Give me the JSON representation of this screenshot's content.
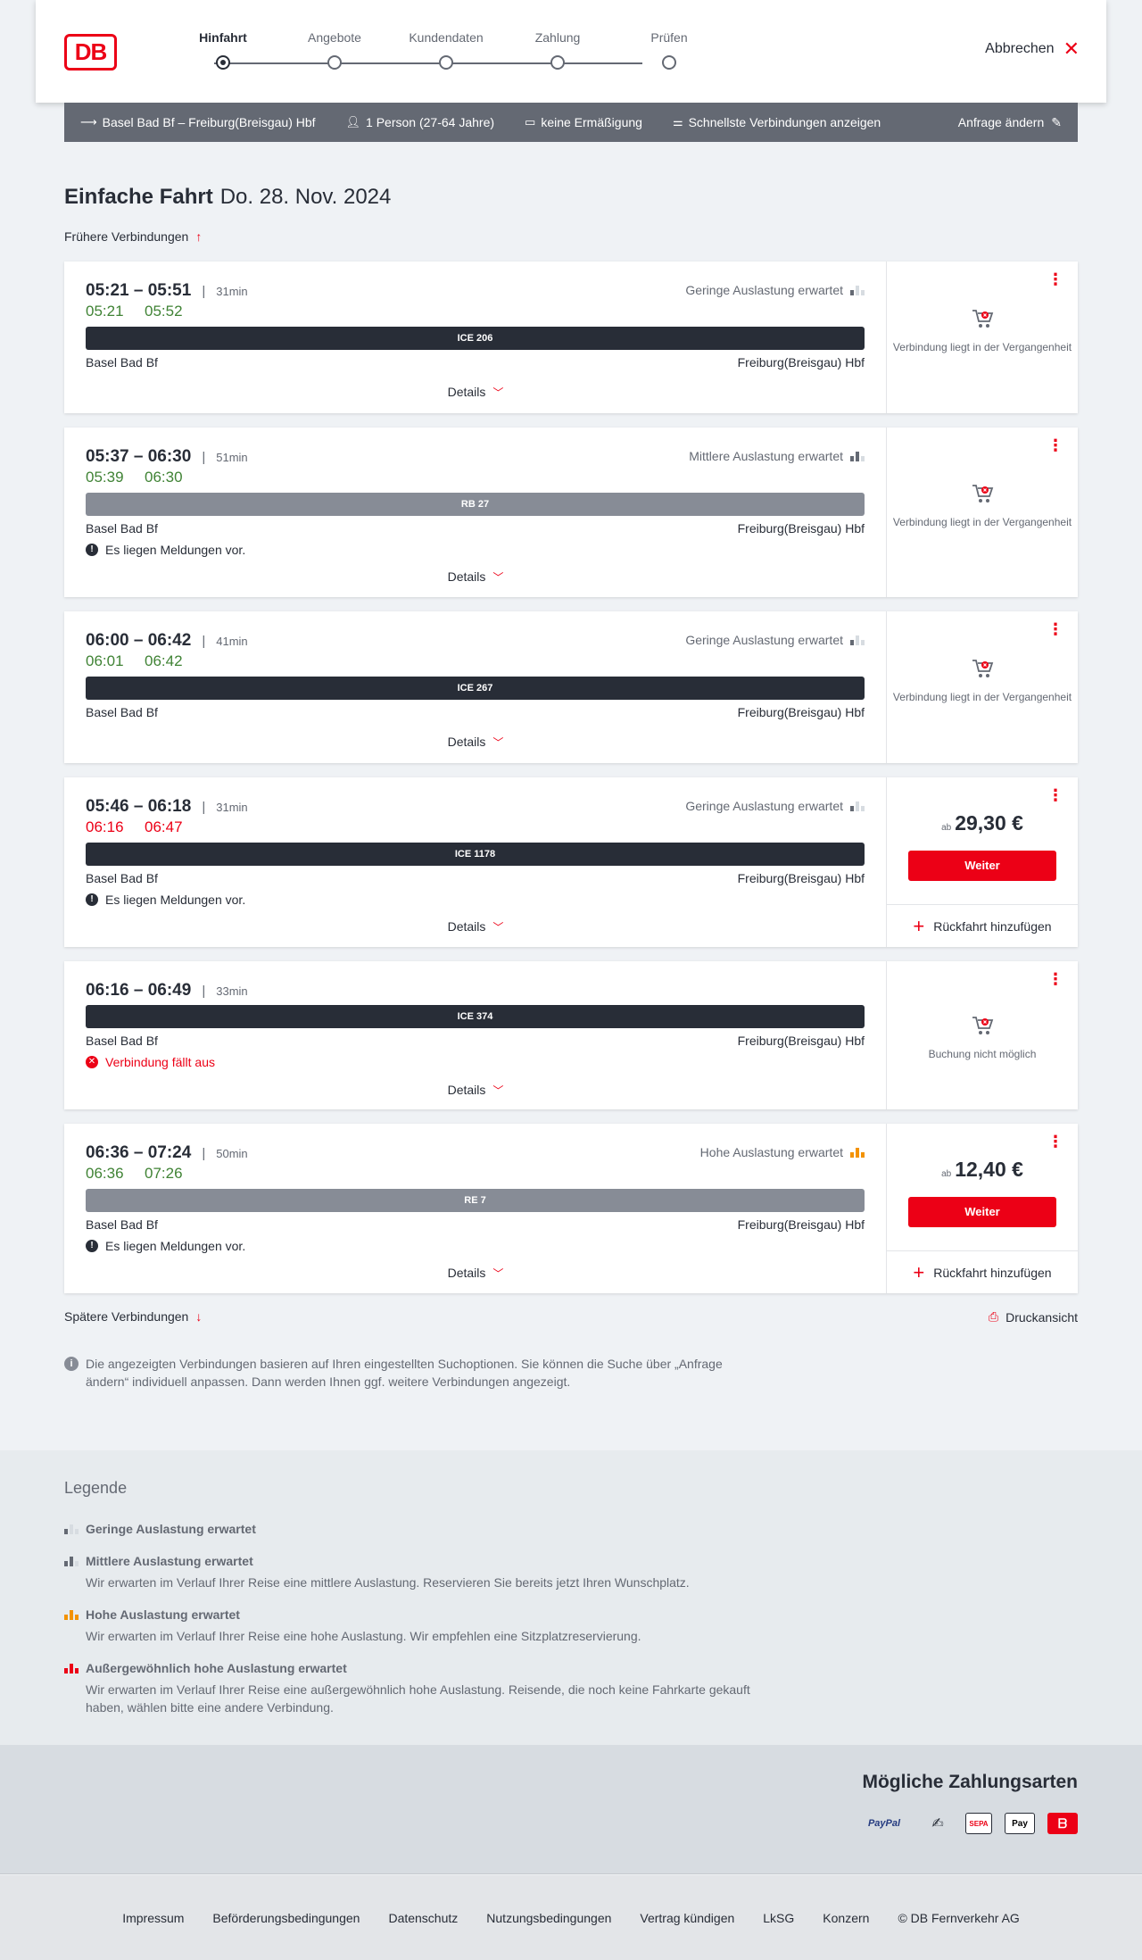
{
  "header": {
    "logo": "DB",
    "steps": [
      {
        "label": "Hinfahrt",
        "active": true
      },
      {
        "label": "Angebote",
        "active": false
      },
      {
        "label": "Kundendaten",
        "active": false
      },
      {
        "label": "Zahlung",
        "active": false
      },
      {
        "label": "Prüfen",
        "active": false
      }
    ],
    "cancel_label": "Abbrechen"
  },
  "summary": {
    "route": "Basel Bad Bf – Freiburg(Breisgau) Hbf",
    "travellers": "1 Person (27-64 Jahre)",
    "discount": "keine Ermäßigung",
    "fastest": "Schnellste Verbindungen anzeigen",
    "edit_label": "Anfrage ändern"
  },
  "title": {
    "type": "Einfache Fahrt",
    "date": "Do. 28. Nov. 2024"
  },
  "earlier_label": "Frühere Verbindungen",
  "later_label": "Spätere Verbindungen",
  "print_label": "Druckansicht",
  "details_label": "Details",
  "connections": [
    {
      "planned": "05:21 – 05:51",
      "duration": "31min",
      "rt_dep": "05:21",
      "rt_arr": "05:52",
      "rt_status": "ok",
      "load": "Geringe Auslastung erwartet",
      "load_level": 1,
      "train": "ICE 206",
      "train_kind": "ice",
      "from": "Basel Bad Bf",
      "to": "Freiburg(Breisgau) Hbf",
      "message": "",
      "side": "past",
      "side_text": "Verbindung liegt in der Vergangenheit"
    },
    {
      "planned": "05:37 – 06:30",
      "duration": "51min",
      "rt_dep": "05:39",
      "rt_arr": "06:30",
      "rt_status": "ok",
      "load": "Mittlere Auslastung erwartet",
      "load_level": 2,
      "train": "RB 27",
      "train_kind": "reg",
      "from": "Basel Bad Bf",
      "to": "Freiburg(Breisgau) Hbf",
      "message": "Es liegen Meldungen vor.",
      "side": "past",
      "side_text": "Verbindung liegt in der Vergangenheit"
    },
    {
      "planned": "06:00 – 06:42",
      "duration": "41min",
      "rt_dep": "06:01",
      "rt_arr": "06:42",
      "rt_status": "ok",
      "load": "Geringe Auslastung erwartet",
      "load_level": 1,
      "train": "ICE 267",
      "train_kind": "ice",
      "from": "Basel Bad Bf",
      "to": "Freiburg(Breisgau) Hbf",
      "message": "",
      "side": "past",
      "side_text": "Verbindung liegt in der Vergangenheit"
    },
    {
      "planned": "05:46 – 06:18",
      "duration": "31min",
      "rt_dep": "06:16",
      "rt_arr": "06:47",
      "rt_status": "late",
      "load": "Geringe Auslastung erwartet",
      "load_level": 1,
      "train": "ICE 1178",
      "train_kind": "ice",
      "from": "Basel Bad Bf",
      "to": "Freiburg(Breisgau) Hbf",
      "message": "Es liegen Meldungen vor.",
      "side": "price",
      "price_prefix": "ab",
      "price": "29,30 €",
      "button": "Weiter",
      "return_label": "Rückfahrt hinzufügen"
    },
    {
      "planned": "06:16 – 06:49",
      "duration": "33min",
      "rt_dep": "",
      "rt_arr": "",
      "rt_status": "none",
      "load": "",
      "load_level": 0,
      "train": "ICE 374",
      "train_kind": "ice",
      "from": "Basel Bad Bf",
      "to": "Freiburg(Breisgau) Hbf",
      "message": "Verbindung fällt aus",
      "side": "unavailable",
      "side_text": "Buchung nicht möglich"
    },
    {
      "planned": "06:36 – 07:24",
      "duration": "50min",
      "rt_dep": "06:36",
      "rt_arr": "07:26",
      "rt_status": "ok",
      "load": "Hohe Auslastung erwartet",
      "load_level": 3,
      "train": "RE 7",
      "train_kind": "reg",
      "from": "Basel Bad Bf",
      "to": "Freiburg(Breisgau) Hbf",
      "message": "Es liegen Meldungen vor.",
      "side": "price",
      "price_prefix": "ab",
      "price": "12,40 €",
      "button": "Weiter",
      "return_label": "Rückfahrt hinzufügen"
    }
  ],
  "info_text": "Die angezeigten Verbindungen basieren auf Ihren eingestellten Suchoptionen. Sie können die Suche über „Anfrage ändern“ individuell anpassen. Dann werden Ihnen ggf. weitere Verbindungen angezeigt.",
  "legend": {
    "title": "Legende",
    "items": [
      {
        "title": "Geringe Auslastung erwartet",
        "desc": ""
      },
      {
        "title": "Mittlere Auslastung erwartet",
        "desc": "Wir erwarten im Verlauf Ihrer Reise eine mittlere Auslastung. Reservieren Sie bereits jetzt Ihren Wunschplatz."
      },
      {
        "title": "Hohe Auslastung erwartet",
        "desc": "Wir erwarten im Verlauf Ihrer Reise eine hohe Auslastung. Wir empfehlen eine Sitzplatzreservierung."
      },
      {
        "title": "Außergewöhnlich hohe Auslastung erwartet",
        "desc": "Wir erwarten im Verlauf Ihrer Reise eine außergewöhnlich hohe Auslastung. Reisende, die noch keine Fahrkarte gekauft haben, wählen bitte eine andere Verbindung."
      }
    ]
  },
  "payment": {
    "title": "Mögliche Zahlungsarten",
    "methods": [
      "PayPal",
      "Lastschrift",
      "SEPA",
      "Pay",
      "DB"
    ]
  },
  "footer": [
    "Impressum",
    "Beförderungsbedingungen",
    "Datenschutz",
    "Nutzungsbedingungen",
    "Vertrag kündigen",
    "LkSG",
    "Konzern",
    "© DB Fernverkehr AG"
  ],
  "colors": {
    "accent": "#ec0016",
    "ok": "#408335",
    "dark": "#282d37",
    "grey": "#646973",
    "high_load": "#f39200"
  }
}
